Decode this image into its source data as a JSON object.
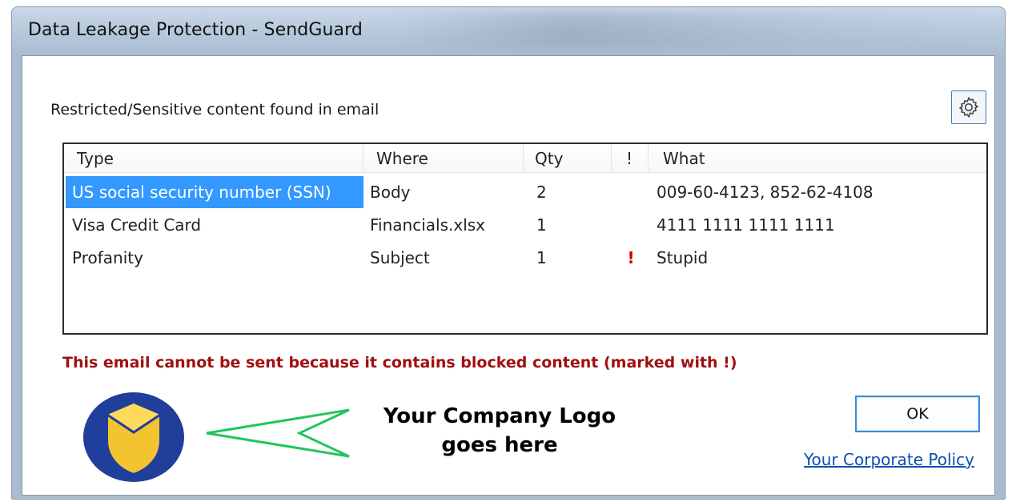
{
  "window": {
    "title": "Data Leakage Protection - SendGuard"
  },
  "dialog": {
    "headline": "Restricted/Sensitive content found in email",
    "settings_icon": "gear-icon",
    "table": {
      "columns": [
        "Type",
        "Where",
        "Qty",
        "!",
        "What"
      ],
      "rows": [
        {
          "type": "US social security number (SSN)",
          "where": "Body",
          "qty": "2",
          "blocked": "",
          "what": "009-60-4123, 852-62-4108",
          "selected": true
        },
        {
          "type": "Visa Credit Card",
          "where": "Financials.xlsx",
          "qty": "1",
          "blocked": "",
          "what": "4111 1111 1111 1111",
          "selected": false
        },
        {
          "type": "Profanity",
          "where": "Subject",
          "qty": "1",
          "blocked": "!",
          "what": "Stupid",
          "selected": false
        }
      ]
    },
    "warning": "This email cannot be sent because it contains blocked content (marked with !)",
    "logo_caption_line1": "Your Company Logo",
    "logo_caption_line2": "goes here",
    "ok_label": "OK",
    "policy_link": "Your Corporate Policy"
  },
  "colors": {
    "selection": "#3399ff",
    "warning_text": "#a01010",
    "blocked_marker": "#d00000",
    "link": "#0b4fb0",
    "logo_blue": "#1f3f9a",
    "logo_gold": "#f4c430",
    "arrow_green": "#22c55e"
  }
}
